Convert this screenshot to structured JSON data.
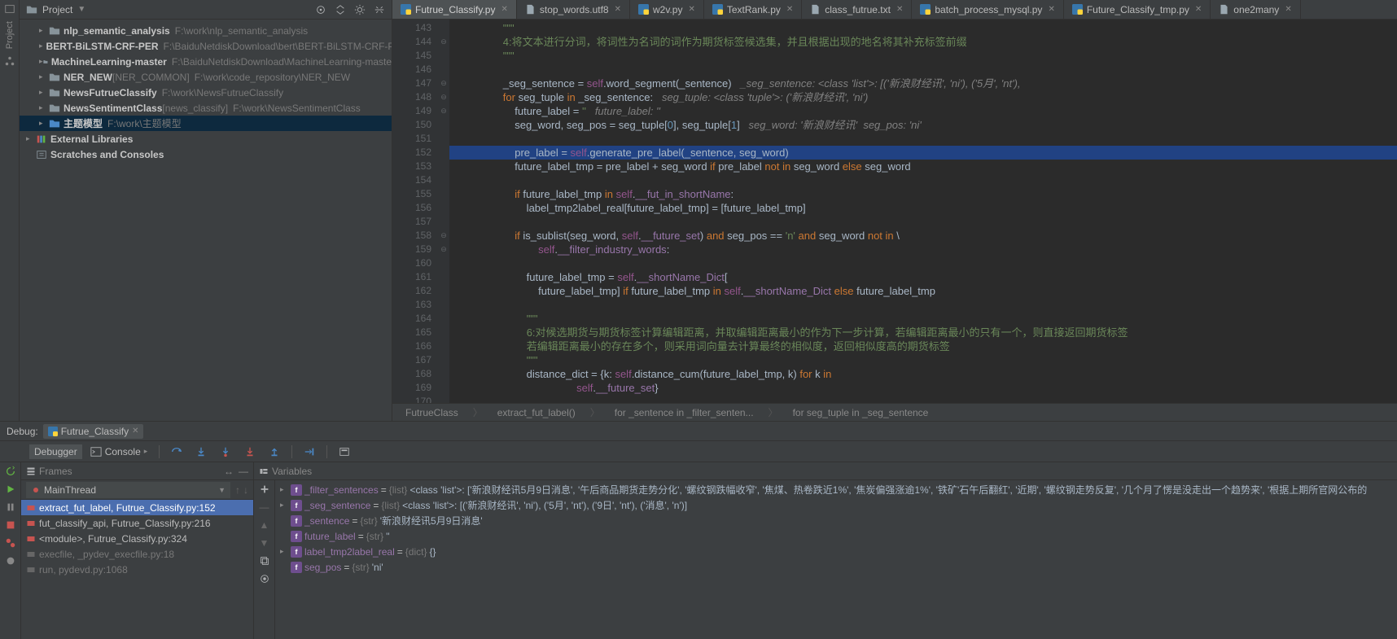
{
  "topbar": {
    "project_label": "Project"
  },
  "project_tree": [
    {
      "name": "nlp_semantic_analysis",
      "path": "F:\\work\\nlp_semantic_analysis",
      "indent": 1
    },
    {
      "name": "BERT-BiLSTM-CRF-PER",
      "path": "F:\\BaiduNetdiskDownload\\bert\\BERT-BiLSTM-CRF-PE",
      "indent": 1
    },
    {
      "name": "MachineLearning-master",
      "path": "F:\\BaiduNetdiskDownload\\MachineLearning-maste",
      "indent": 1
    },
    {
      "name": "NER_NEW",
      "bracket": "[NER_COMMON]",
      "path": "F:\\work\\code_repository\\NER_NEW",
      "indent": 1
    },
    {
      "name": "NewsFutrueClassify",
      "path": "F:\\work\\NewsFutrueClassify",
      "indent": 1
    },
    {
      "name": "NewsSentimentClass",
      "bracket": "[news_classify]",
      "path": "F:\\work\\NewsSentimentClass",
      "indent": 1
    },
    {
      "name": "主题模型",
      "path": "F:\\work\\主题模型",
      "indent": 1,
      "selected": true,
      "blue": true
    },
    {
      "name": "External Libraries",
      "indent": 0,
      "lib": true
    },
    {
      "name": "Scratches and Consoles",
      "indent": 0,
      "scratch": true
    }
  ],
  "tabs": [
    {
      "label": "Futrue_Classify.py",
      "type": "py",
      "active": true
    },
    {
      "label": "stop_words.utf8",
      "type": "txt"
    },
    {
      "label": "w2v.py",
      "type": "py"
    },
    {
      "label": "TextRank.py",
      "type": "py"
    },
    {
      "label": "class_futrue.txt",
      "type": "txt"
    },
    {
      "label": "batch_process_mysql.py",
      "type": "py"
    },
    {
      "label": "Future_Classify_tmp.py",
      "type": "py"
    },
    {
      "label": "one2many",
      "type": "txt"
    }
  ],
  "code": {
    "start": 143,
    "lines": [
      "                <span class='s'>\"\"\"</span>",
      "                <span class='s'>4:将文本进行分词，将词性为名词的词作为期货标签候选集，并且根据出现的地名将其补充标签前缀</span>",
      "                <span class='s'>\"\"\"</span>",
      "",
      "                _seg_sentence = <span class='se'>self</span>.word_segment(_sentence)   <span class='c'>_seg_sentence: &lt;class 'list'&gt;: [('新浪财经讯', 'ni'), ('5月', 'nt'),</span>",
      "                <span class='k'>for</span> seg_tuple <span class='k'>in</span> _seg_sentence:   <span class='c'>seg_tuple: &lt;class 'tuple'&gt;: ('新浪财经讯', 'ni')</span>",
      "                    future_label = <span class='s'>''</span>   <span class='c'>future_label: ''</span>",
      "                    seg_word, seg_pos = seg_tuple[<span class='n'>0</span>], seg_tuple[<span class='n'>1</span>]   <span class='c'>seg_word: '新浪财经讯'  seg_pos: 'ni'</span>",
      "",
      "                    pre_label = <span class='se'>self</span>.generate_pre_label(_sentence, seg_word)",
      "                    future_label_tmp = pre_label + seg_word <span class='k'>if</span> pre_label <span class='k'>not in</span> seg_word <span class='k'>else</span> seg_word",
      "",
      "                    <span class='k'>if</span> future_label_tmp <span class='k'>in</span> <span class='se'>self</span>.<span class='fi'>__fut_in_shortName</span>:",
      "                        label_tmp2label_real[future_label_tmp] = [future_label_tmp]",
      "",
      "                    <span class='k'>if</span> is_sublist(seg_word, <span class='se'>self</span>.<span class='fi'>__future_set</span>) <span class='k'>and</span> seg_pos == <span class='s'>'n'</span> <span class='k'>and</span> seg_word <span class='k'>not in</span> \\",
      "                            <span class='se'>self</span>.<span class='fi'>__filter_industry_words</span>:",
      "",
      "                        future_label_tmp = <span class='se'>self</span>.<span class='fi'>__shortName_Dict</span>[",
      "                            future_label_tmp] <span class='k'>if</span> future_label_tmp <span class='k'>in</span> <span class='se'>self</span>.<span class='fi'>__shortName_Dict</span> <span class='k'>else</span> future_label_tmp",
      "",
      "                        <span class='s'>\"\"\"</span>",
      "                        <span class='s'>6:对候选期货与期货标签计算编辑距离，并取编辑距离最小的作为下一步计算，若编辑距离最小的只有一个，则直接返回期货标签</span>",
      "                        <span class='s'>若编辑距离最小的存在多个，则采用词向量去计算最终的相似度，返回相似度高的期货标签</span>",
      "                        <span class='s'>\"\"\"</span>",
      "                        distance_dict = {k: <span class='se'>self</span>.distance_cum(future_label_tmp, k) <span class='k'>for</span> k <span class='k'>in</span>",
      "                                         <span class='se'>self</span>.<span class='fi'>__future_set</span>}",
      ""
    ],
    "highlight": 152,
    "breakpoint": 152,
    "folds": [
      144,
      147,
      148,
      149,
      158,
      159
    ]
  },
  "breadcrumb": [
    "FutrueClass",
    "extract_fut_label()",
    "for _sentence in _filter_senten...",
    "for seg_tuple in _seg_sentence"
  ],
  "debug": {
    "title": "Debug:",
    "tab": "Futrue_Classify",
    "toolbar": {
      "debugger": "Debugger",
      "console": "Console"
    },
    "frames_label": "Frames",
    "variables_label": "Variables",
    "thread": "MainThread",
    "stack": [
      {
        "label": "extract_fut_label, Futrue_Classify.py:152",
        "sel": true
      },
      {
        "label": "fut_classify_api, Futrue_Classify.py:216"
      },
      {
        "label": "<module>, Futrue_Classify.py:324"
      },
      {
        "label": "execfile, _pydev_execfile.py:18",
        "dim": true
      },
      {
        "label": "run, pydevd.py:1068",
        "dim": true
      }
    ],
    "vars": [
      {
        "arrow": true,
        "name": "_filter_sentences",
        "type": "{list}",
        "val": "<class 'list'>: ['新浪财经讯5月9日消息', '午后商品期货走势分化', '螺纹钢跌幅收窄', '焦煤、热卷跌近1%', '焦炭偏强涨逾1%', '铁矿'石午后翻红', '近期', '螺纹钢走势反复', '几个月了愣是没走出一个趋势来', '根据上期所官网公布的"
      },
      {
        "arrow": true,
        "name": "_seg_sentence",
        "type": "{list}",
        "val": "<class 'list'>: [('新浪财经讯', 'ni'), ('5月', 'nt'), ('9日', 'nt'), ('消息', 'n')]"
      },
      {
        "arrow": false,
        "name": "_sentence",
        "type": "{str}",
        "val": "'新浪财经讯5月9日消息'"
      },
      {
        "arrow": false,
        "name": "future_label",
        "type": "{str}",
        "val": "''"
      },
      {
        "arrow": true,
        "name": "label_tmp2label_real",
        "type": "{dict}",
        "val": "{}"
      },
      {
        "arrow": false,
        "name": "seg_pos",
        "type": "{str}",
        "val": "'ni'"
      }
    ]
  }
}
